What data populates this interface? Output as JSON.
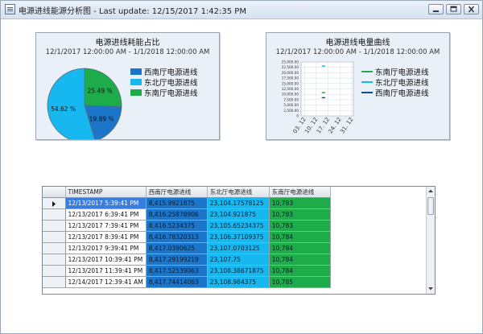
{
  "window": {
    "title": "电源进线能源分析图 - Last update: 12/15/2017 1:42:35 PM",
    "icons": {
      "app": "chart-window-icon",
      "min": "minimize-icon",
      "max": "maximize-icon",
      "close": "close-icon"
    }
  },
  "colors": {
    "southwest": "#1b75c8",
    "northeast": "#16b8ef",
    "southeast": "#1eab4a",
    "panel_bg": "#eaf0f7",
    "selected_row": "#3b7ddd"
  },
  "chart_data": [
    {
      "type": "pie",
      "title": "电源进线耗能占比",
      "subtitle": "12/1/2017 12:00:00 AM - 1/1/2018 12:00:00 AM",
      "slices": [
        {
          "label": "西南厅电源进线",
          "value": 19.89,
          "display": "19.89 %",
          "color": "#1b75c8"
        },
        {
          "label": "东北厅电源进线",
          "value": 54.62,
          "display": "54.62 %",
          "color": "#16b8ef"
        },
        {
          "label": "东南厅电源进线",
          "value": 25.49,
          "display": "25.49 %",
          "color": "#1eab4a"
        }
      ],
      "legend_position": "right"
    },
    {
      "type": "line",
      "title": "电源进线电量曲线",
      "subtitle": "12/1/2017 12:00:00 AM - 1/1/2018 12:00:00 AM",
      "ylim": [
        0,
        25000
      ],
      "yticks": [
        0,
        2500,
        5000,
        7500,
        10000,
        12500,
        15000,
        17500,
        20000,
        22500,
        25000
      ],
      "ytick_labels": [
        "0",
        "2,500.00",
        "5,000.00",
        "7,500.00",
        "10,000.00",
        "12,500.00",
        "15,000.00",
        "17,500.00",
        "20,000.00",
        "22,500.00",
        "25,000.00"
      ],
      "xlim": [
        0,
        31
      ],
      "xticks": [
        2,
        9,
        16,
        23,
        30
      ],
      "xtick_labels": [
        "03. 12",
        "10. 12",
        "17. 12",
        "24. 12",
        "31. 12"
      ],
      "grid": true,
      "legend_position": "right",
      "series": [
        {
          "name": "东南厅电源进线",
          "color": "#1eab4a",
          "x": [
            12.5,
            13.0,
            13.5,
            14.0
          ],
          "y": [
            10780,
            10783,
            10784,
            10785
          ]
        },
        {
          "name": "东北厅电源进线",
          "color": "#16b8ef",
          "x": [
            12.5,
            13.0,
            13.5,
            14.0
          ],
          "y": [
            23104,
            23105,
            23107,
            23108
          ]
        },
        {
          "name": "西南厅电源进线",
          "color": "#0f4c8a",
          "x": [
            12.5,
            13.0,
            13.5,
            14.0
          ],
          "y": [
            8415,
            8416,
            8417,
            8417
          ]
        }
      ]
    }
  ],
  "table": {
    "columns": [
      "TIMESTAMP",
      "西南厅电源进线",
      "东北厅电源进线",
      "东南厅电源进线"
    ],
    "rows": [
      [
        "12/13/2017 5:39:41 PM",
        "8,415.9921875",
        "23,104.17578125",
        "10,783"
      ],
      [
        "12/13/2017 6:39:41 PM",
        "8,416.25878906",
        "23,104.921875",
        "10,783"
      ],
      [
        "12/13/2017 7:39:41 PM",
        "8,416.5234375",
        "23,105.65234375",
        "10,783"
      ],
      [
        "12/13/2017 8:39:41 PM",
        "8,416.78320313",
        "23,106.37109375",
        "10,784"
      ],
      [
        "12/13/2017 9:39:41 PM",
        "8,417.0390625",
        "23,107.0703125",
        "10,784"
      ],
      [
        "12/13/2017 10:39:41 PM",
        "8,417.29199219",
        "23,107.75",
        "10,784"
      ],
      [
        "12/13/2017 11:39:41 PM",
        "8,417.52539063",
        "23,108.38671875",
        "10,784"
      ],
      [
        "12/14/2017 12:39:41 AM",
        "8,417.74414063",
        "23,108.984375",
        "10,785"
      ]
    ],
    "selected_row": 0,
    "icons": {
      "row_pointer": "row-pointer-icon",
      "scroll_up": "scroll-up-icon",
      "scroll_down": "scroll-down-icon"
    }
  }
}
